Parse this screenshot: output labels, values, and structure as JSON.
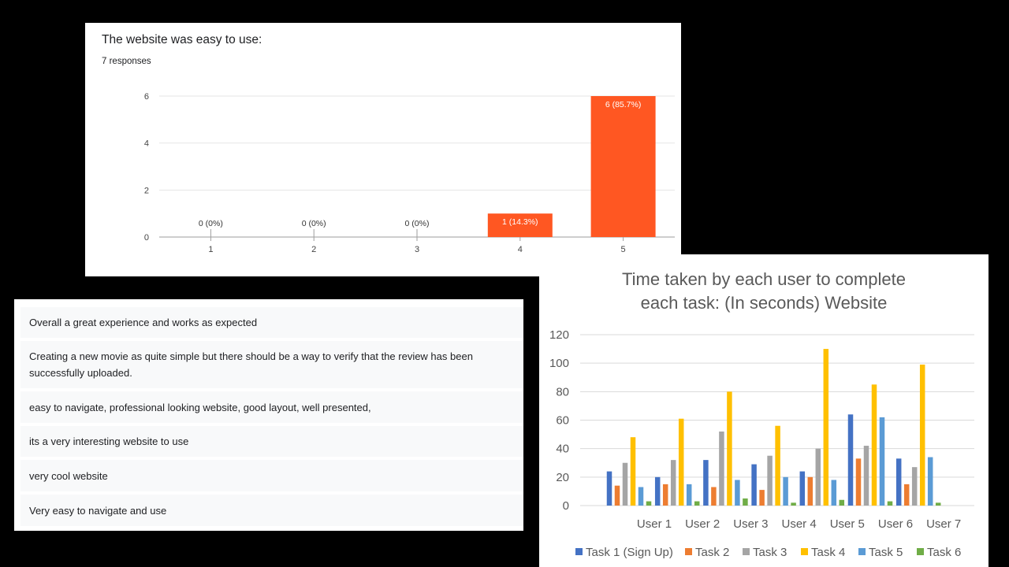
{
  "chart_data": [
    {
      "type": "bar",
      "title": "The website was easy to use:",
      "subtitle": "7 responses",
      "categories": [
        "1",
        "2",
        "3",
        "4",
        "5"
      ],
      "values": [
        0,
        0,
        0,
        1,
        6
      ],
      "data_labels": [
        "0 (0%)",
        "0 (0%)",
        "0 (0%)",
        "1 (14.3%)",
        "6 (85.7%)"
      ],
      "yticks": [
        "0",
        "2",
        "4",
        "6"
      ],
      "ylim": [
        0,
        6
      ],
      "bar_color": "#ff5722",
      "grid": true
    },
    {
      "type": "bar",
      "title_lines": [
        "Time taken by each user to complete",
        "each task: (In seconds) Website"
      ],
      "categories": [
        "User 1",
        "User 2",
        "User 3",
        "User 4",
        "User 5",
        "User 6",
        "User 7"
      ],
      "series": [
        {
          "name": "Task 1 (Sign Up)",
          "color": "#4472c4",
          "values": [
            24,
            20,
            32,
            29,
            24,
            64,
            33
          ]
        },
        {
          "name": "Task 2",
          "color": "#ed7d31",
          "values": [
            14,
            15,
            13,
            11,
            20,
            33,
            15
          ]
        },
        {
          "name": "Task 3",
          "color": "#a5a5a5",
          "values": [
            30,
            32,
            52,
            35,
            40,
            42,
            27
          ]
        },
        {
          "name": "Task 4",
          "color": "#ffc000",
          "values": [
            48,
            61,
            80,
            56,
            110,
            85,
            99
          ]
        },
        {
          "name": "Task 5",
          "color": "#5b9bd5",
          "values": [
            13,
            15,
            18,
            20,
            18,
            62,
            34
          ]
        },
        {
          "name": "Task 6",
          "color": "#70ad47",
          "values": [
            3,
            3,
            5,
            2,
            4,
            3,
            2
          ]
        }
      ],
      "yticks": [
        "0",
        "20",
        "40",
        "60",
        "80",
        "100",
        "120"
      ],
      "ylim": [
        0,
        120
      ],
      "grid": true,
      "legend_position": "bottom"
    }
  ],
  "responses": [
    "Overall a great experience and works as expected",
    "Creating a new movie as quite simple but there should be a way to verify that the review has been successfully uploaded.",
    "easy to navigate, professional looking website, good layout, well presented,",
    "its a very interesting website to use",
    "very cool website",
    "Very easy to navigate and use"
  ]
}
